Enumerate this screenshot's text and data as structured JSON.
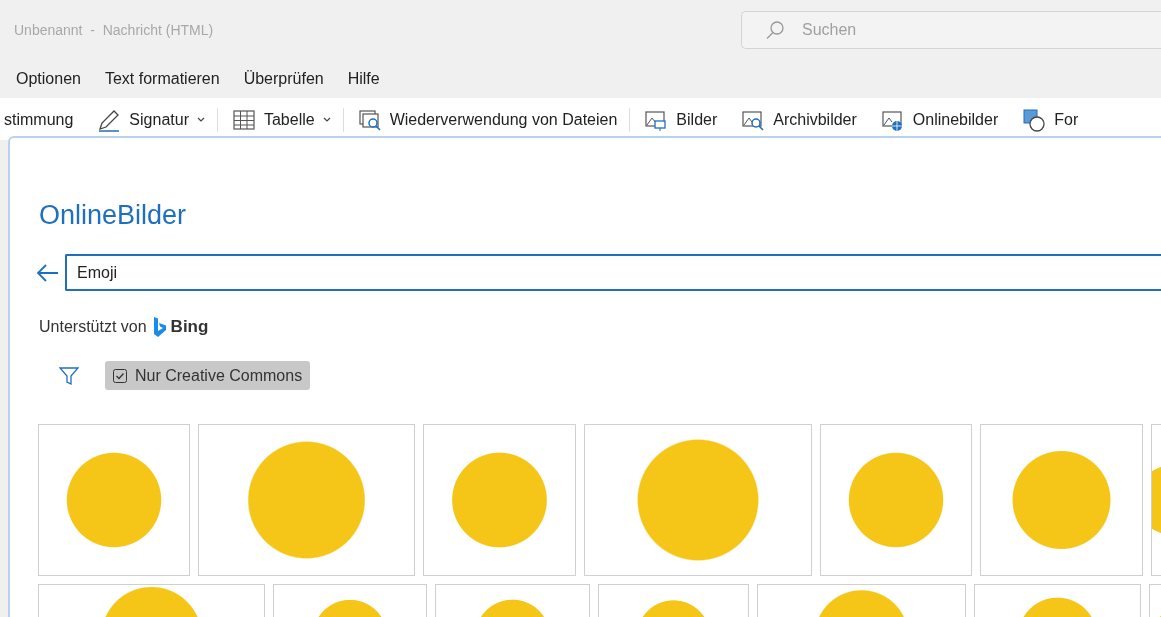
{
  "window": {
    "title": "Unbenannt  -  Nachricht (HTML)"
  },
  "search": {
    "placeholder": "Suchen"
  },
  "menu": [
    {
      "label": "Optionen"
    },
    {
      "label": "Text formatieren"
    },
    {
      "label": "Überprüfen"
    },
    {
      "label": "Hilfe"
    }
  ],
  "ribbon": [
    {
      "label": "stimmung",
      "kind": "none",
      "dropdown": false,
      "separator_after": false
    },
    {
      "label": "Signatur",
      "kind": "pen",
      "dropdown": true,
      "separator_after": true
    },
    {
      "label": "Tabelle",
      "kind": "table",
      "dropdown": true,
      "separator_after": true
    },
    {
      "label": "Wiederverwendung von Dateien",
      "kind": "reuse",
      "dropdown": false,
      "separator_after": true
    },
    {
      "label": "Bilder",
      "kind": "pictures",
      "dropdown": false,
      "separator_after": false
    },
    {
      "label": "Archivbilder",
      "kind": "stock",
      "dropdown": false,
      "separator_after": false
    },
    {
      "label": "Onlinebilder",
      "kind": "online",
      "dropdown": false,
      "separator_after": false
    },
    {
      "label": "For",
      "kind": "shapes",
      "dropdown": false,
      "separator_after": false
    }
  ],
  "dialog": {
    "title": "OnlineBilder",
    "query": "Emoji",
    "powered_by": "Unterstützt von",
    "brand": "Bing",
    "filter": {
      "label": "Nur Creative Commons",
      "checked": true
    }
  }
}
